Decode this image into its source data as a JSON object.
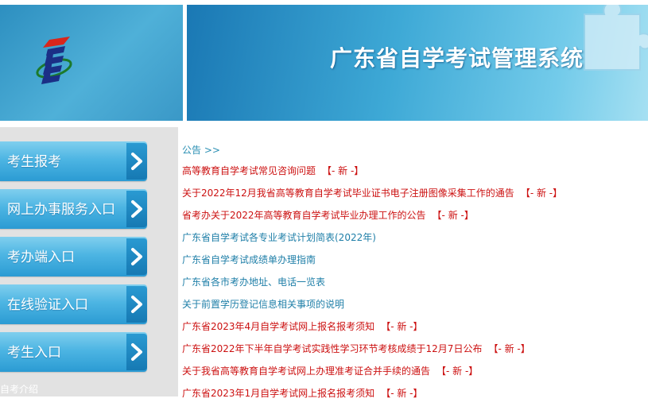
{
  "banner": {
    "title": "广东省自学考试管理系统"
  },
  "sidebar": {
    "buttons": [
      {
        "label": "考生报考"
      },
      {
        "label": "网上办事服务入口"
      },
      {
        "label": "考办端入口"
      },
      {
        "label": "在线验证入口"
      },
      {
        "label": "考生入口"
      }
    ],
    "intro_label": "自考介绍"
  },
  "notices": {
    "header": "公告 >>",
    "new_tag": "【- 新 -】",
    "items": [
      {
        "text": "高等教育自学考试常见咨询问题",
        "highlight": true,
        "is_new": true
      },
      {
        "text": "关于2022年12月我省高等教育自学考试毕业证书电子注册图像采集工作的通告",
        "highlight": true,
        "is_new": true
      },
      {
        "text": "省考办关于2022年高等教育自学考试毕业办理工作的公告",
        "highlight": true,
        "is_new": true
      },
      {
        "text": "广东省自学考试各专业考试计划简表(2022年)",
        "highlight": false,
        "is_new": false
      },
      {
        "text": "广东省自学考试成绩单办理指南",
        "highlight": false,
        "is_new": false
      },
      {
        "text": "广东省各市考办地址、电话一览表",
        "highlight": false,
        "is_new": false
      },
      {
        "text": "关于前置学历登记信息相关事项的说明",
        "highlight": false,
        "is_new": false
      },
      {
        "text": "广东省2023年4月自学考试网上报名报考须知",
        "highlight": true,
        "is_new": true
      },
      {
        "text": "广东省2022年下半年自学考试实践性学习环节考核成绩于12月7日公布",
        "highlight": true,
        "is_new": true
      },
      {
        "text": "关于我省高等教育自学考试网上办理准考证合并手续的通告",
        "highlight": true,
        "is_new": true
      },
      {
        "text": "广东省2023年1月自学考试网上报名报考须知",
        "highlight": true,
        "is_new": true
      }
    ]
  },
  "colors": {
    "notice_red": "#cc1111",
    "notice_teal": "#1f7fa8",
    "nav_blue": "#4db5e3"
  }
}
